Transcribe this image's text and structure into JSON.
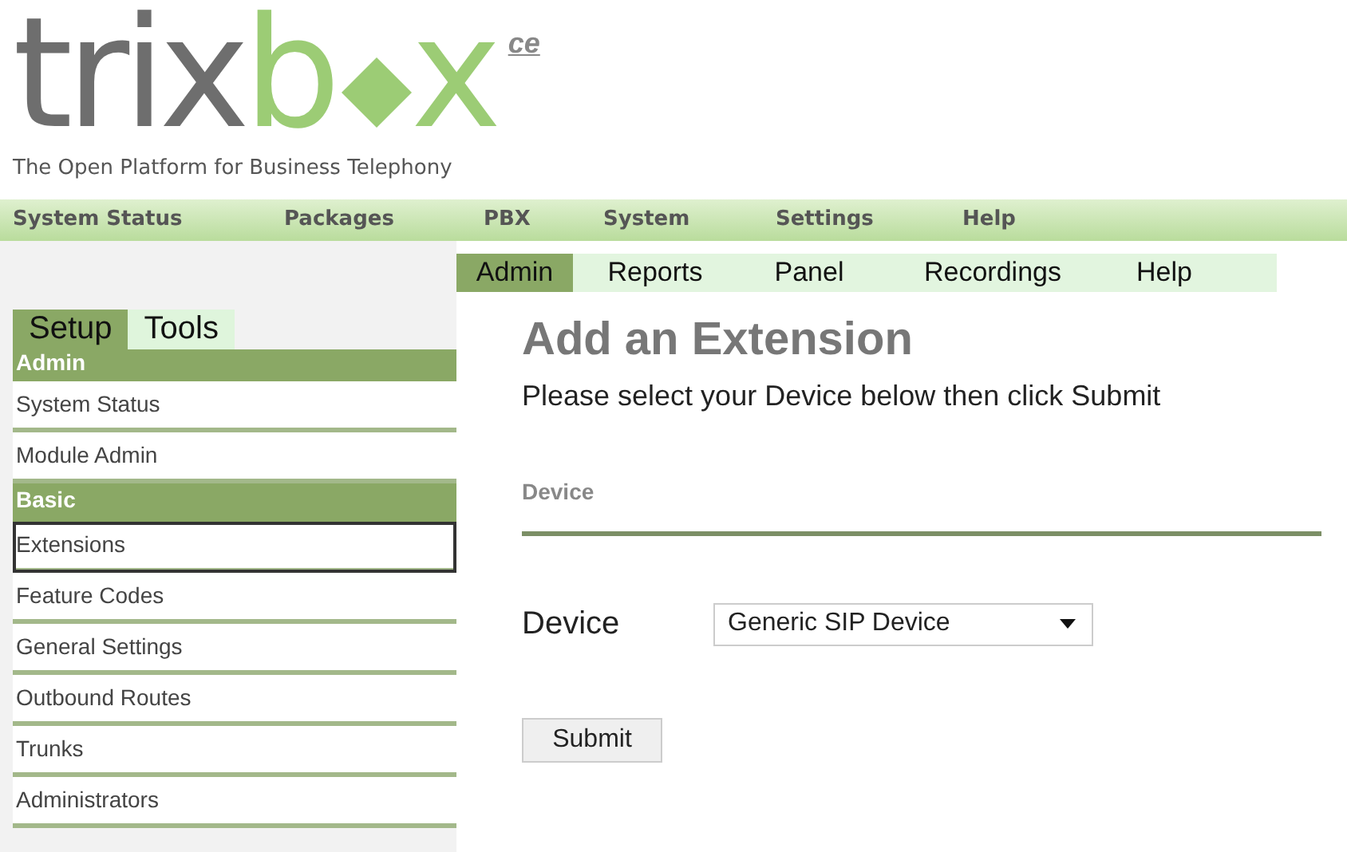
{
  "logo": {
    "part_1": "trix",
    "part_2": "b",
    "part_3": "x",
    "edition": "ce",
    "tagline": "The Open Platform for Business Telephony"
  },
  "top_nav": [
    "System Status",
    "Packages",
    "PBX",
    "System",
    "Settings",
    "Help"
  ],
  "sub_nav": [
    {
      "label": "Admin",
      "selected": true
    },
    {
      "label": "Reports",
      "selected": false
    },
    {
      "label": "Panel",
      "selected": false
    },
    {
      "label": "Recordings",
      "selected": false
    },
    {
      "label": "Help",
      "selected": false
    }
  ],
  "sidebar": {
    "tabs": [
      {
        "label": "Setup",
        "selected": true
      },
      {
        "label": "Tools",
        "selected": false
      }
    ],
    "items": [
      {
        "kind": "header",
        "label": "Admin"
      },
      {
        "kind": "link",
        "label": "System Status",
        "selected": false
      },
      {
        "kind": "link",
        "label": "Module Admin",
        "selected": false
      },
      {
        "kind": "header",
        "label": "Basic"
      },
      {
        "kind": "link",
        "label": "Extensions",
        "selected": true
      },
      {
        "kind": "link",
        "label": "Feature Codes",
        "selected": false
      },
      {
        "kind": "link",
        "label": "General Settings",
        "selected": false
      },
      {
        "kind": "link",
        "label": "Outbound Routes",
        "selected": false
      },
      {
        "kind": "link",
        "label": "Trunks",
        "selected": false
      },
      {
        "kind": "link",
        "label": "Administrators",
        "selected": false
      }
    ]
  },
  "main": {
    "title": "Add an Extension",
    "instructions": "Please select your Device below then click Submit",
    "section": "Device",
    "device_label": "Device",
    "device_value": "Generic SIP Device",
    "submit": "Submit"
  }
}
